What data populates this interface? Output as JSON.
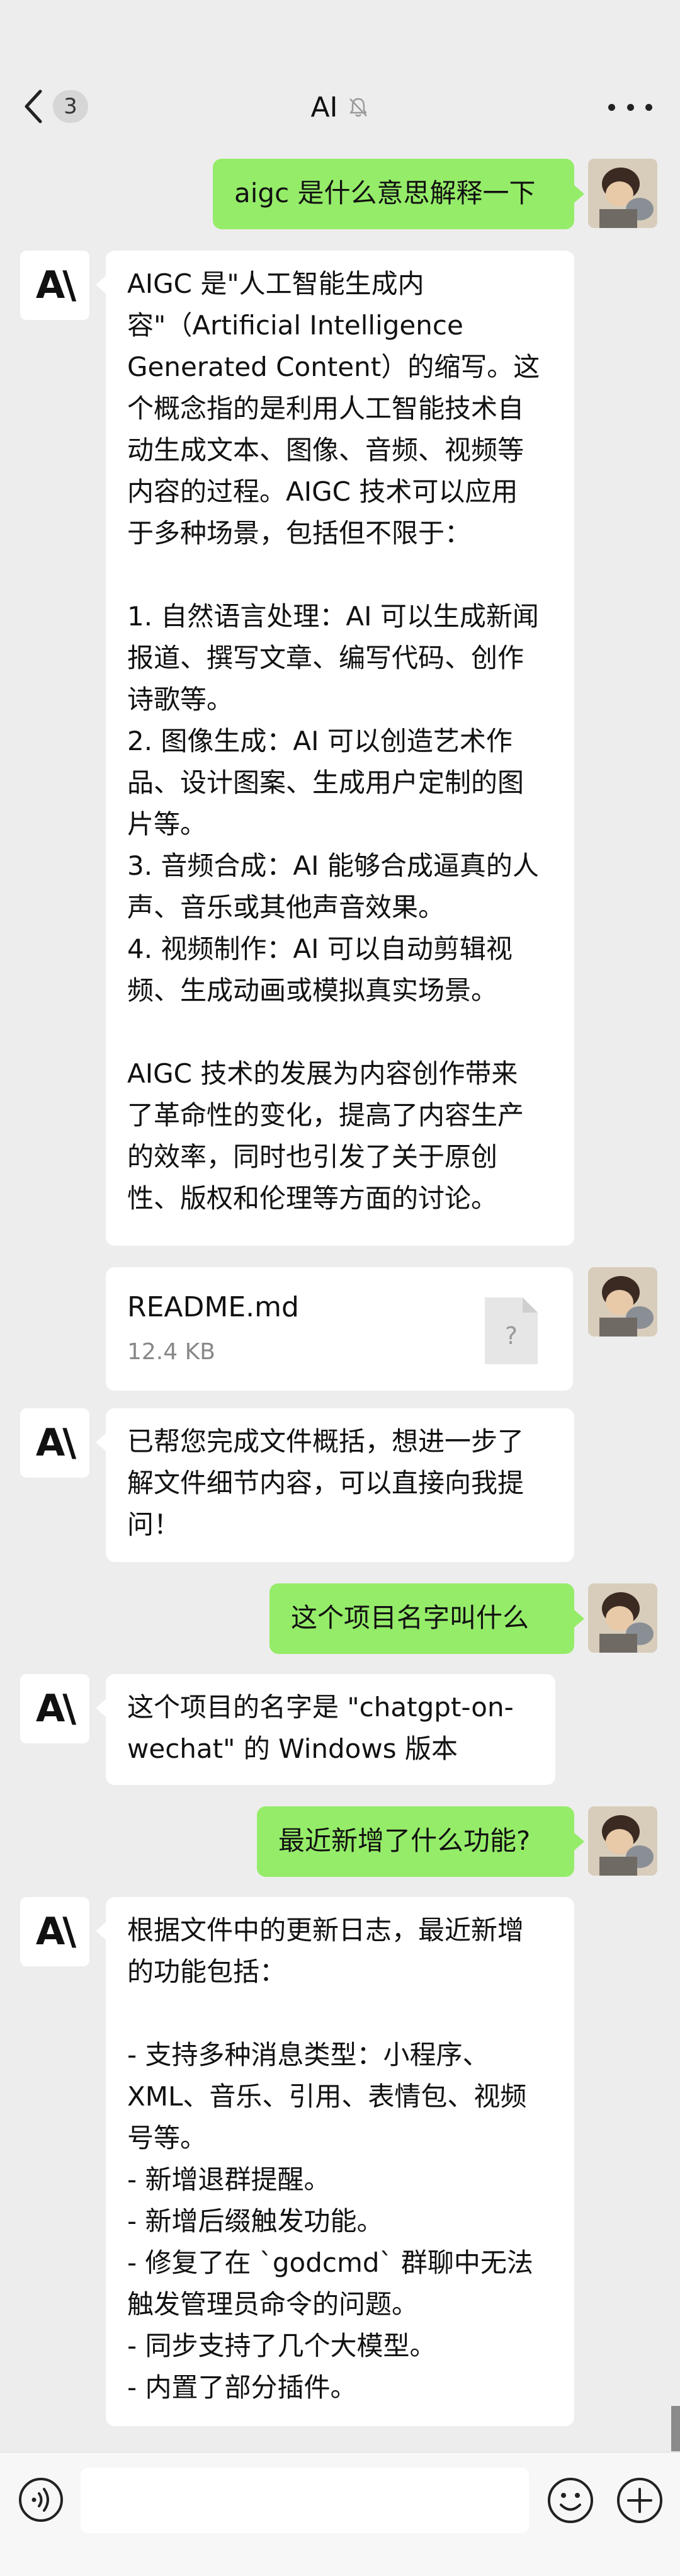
{
  "header": {
    "back_badge": "3",
    "title": "AI"
  },
  "bot": {
    "avatar_logo": "A\\"
  },
  "messages": [
    {
      "from": "user",
      "text": "aigc 是什么意思解释一下"
    },
    {
      "from": "bot",
      "text": "AIGC 是\"人工智能生成内\n容\"（Artificial Intelligence\nGenerated Content）的缩写。这\n个概念指的是利用人工智能技术自\n动生成文本、图像、音频、视频等\n内容的过程。AIGC 技术可以应用\n于多种场景，包括但不限于：\n\n1. 自然语言处理：AI 可以生成新闻\n报道、撰写文章、编写代码、创作\n诗歌等。\n2. 图像生成：AI 可以创造艺术作\n品、设计图案、生成用户定制的图\n片等。\n3. 音频合成：AI 能够合成逼真的人\n声、音乐或其他声音效果。\n4. 视频制作：AI 可以自动剪辑视\n频、生成动画或模拟真实场景。\n\nAIGC 技术的发展为内容创作带来\n了革命性的变化，提高了内容生产\n的效率，同时也引发了关于原创\n性、版权和伦理等方面的讨论。"
    },
    {
      "from": "user",
      "file_name": "README.md",
      "file_size": "12.4 KB"
    },
    {
      "from": "bot",
      "text": "已帮您完成文件概括，想进一步了\n解文件细节内容，可以直接向我提\n问！"
    },
    {
      "from": "user",
      "text": "这个项目名字叫什么"
    },
    {
      "from": "bot",
      "text": "这个项目的名字是 \"chatgpt-on-\nwechat\" 的 Windows 版本"
    },
    {
      "from": "user",
      "text": "最近新增了什么功能?"
    },
    {
      "from": "bot",
      "text": "根据文件中的更新日志，最近新增\n的功能包括：\n\n- 支持多种消息类型：小程序、\nXML、音乐、引用、表情包、视频\n号等。\n- 新增退群提醒。\n- 新增后缀触发功能。\n- 修复了在 `godcmd` 群聊中无法\n触发管理员命令的问题。\n- 同步支持了几个大模型。\n- 内置了部分插件。"
    }
  ],
  "icons": {
    "back": "chevron-left-icon",
    "mute": "bell-off-icon",
    "more": "more-dots-icon",
    "file": "unknown-file-icon",
    "voice": "voice-icon",
    "emoji": "emoji-icon",
    "plus": "plus-icon"
  },
  "colors": {
    "user_bubble": "#95ec69",
    "bot_bubble": "#ffffff",
    "background": "#ededed"
  }
}
